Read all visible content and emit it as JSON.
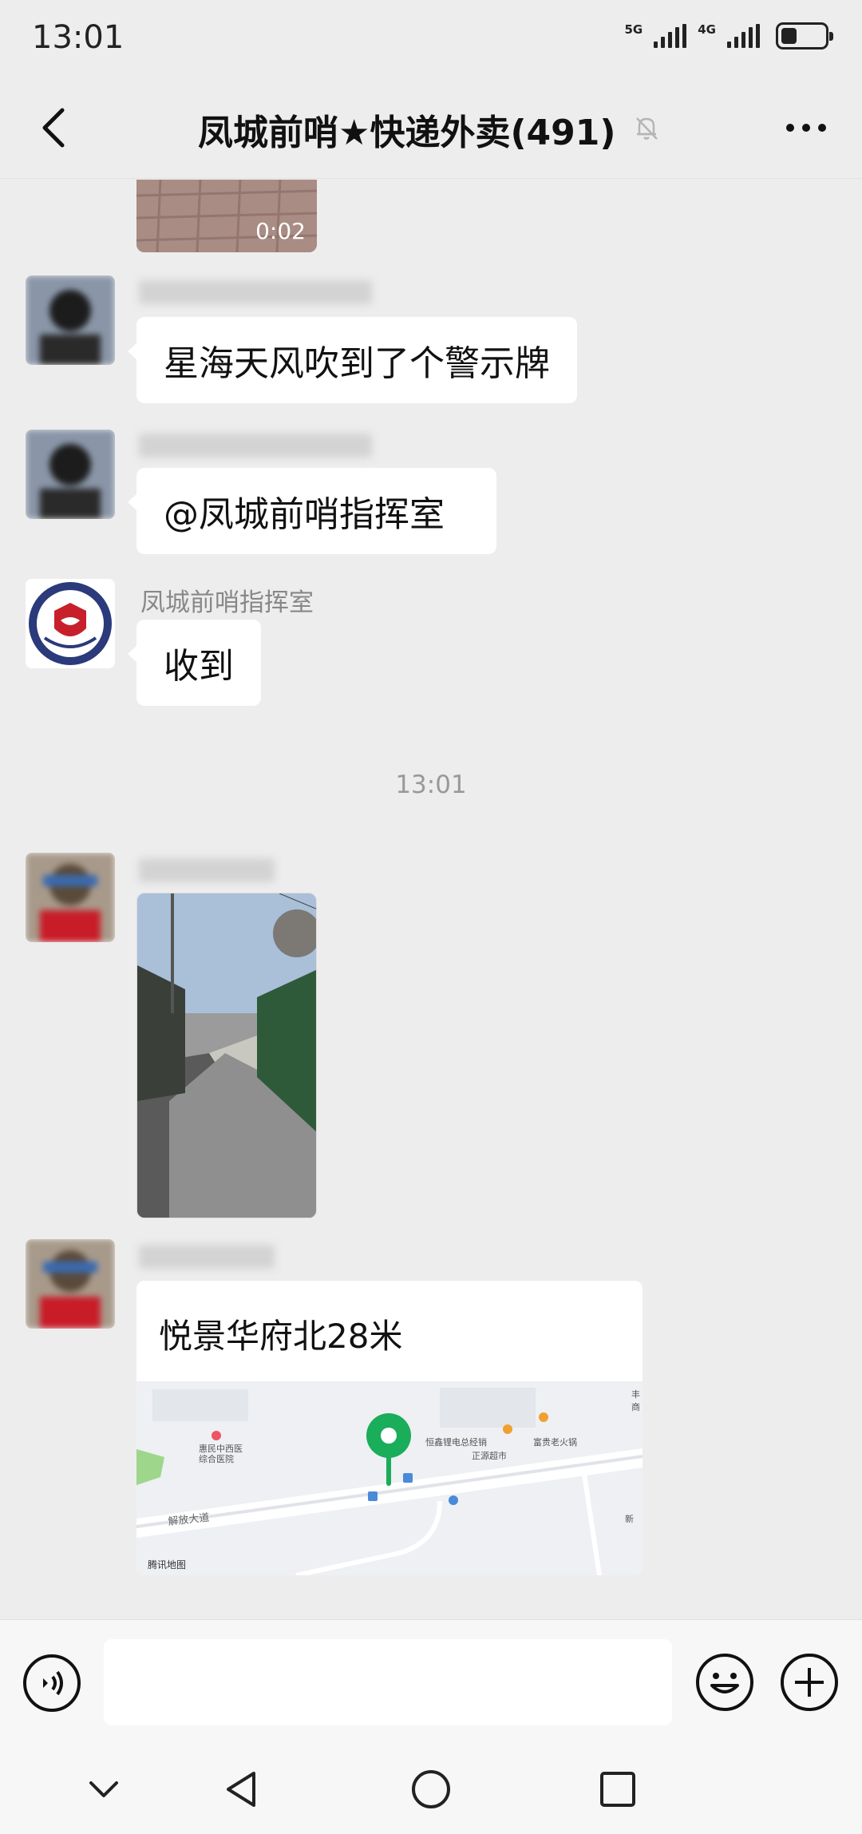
{
  "status_bar": {
    "time": "13:01",
    "network_1": "5G",
    "network_2": "4G",
    "battery_level": 0.35
  },
  "header": {
    "title": "凤城前哨★快递外卖(491)",
    "back_icon": "chevron-left-icon",
    "mute_icon": "bell-off-icon",
    "more_icon": "more-dots-icon"
  },
  "messages": [
    {
      "type": "video",
      "duration": "0:02"
    },
    {
      "type": "text",
      "sender": "",
      "text": "星海天风吹到了个警示牌"
    },
    {
      "type": "text",
      "sender": "",
      "text": "@凤城前哨指挥室"
    },
    {
      "type": "text",
      "sender": "凤城前哨指挥室",
      "text": "收到"
    },
    {
      "type": "timestamp",
      "text": "13:01"
    },
    {
      "type": "image",
      "sender": ""
    },
    {
      "type": "location",
      "sender": "",
      "title": "悦景华府北28米",
      "map_labels": {
        "hospital": "惠民中西医\n综合医院",
        "shop1": "恒鑫锂电总经销",
        "shop2": "富贵老火锅",
        "market": "正源超市",
        "road": "解放大道",
        "right1": "丰",
        "right2": "商",
        "right3": "新",
        "brand": "腾讯地图"
      }
    }
  ],
  "input": {
    "placeholder": "",
    "voice_icon": "voice-icon",
    "emoji_icon": "emoji-icon",
    "plus_icon": "plus-icon"
  },
  "nav": {
    "icons": [
      "chevron-down-icon",
      "back-triangle-icon",
      "home-circle-icon",
      "recents-square-icon"
    ]
  },
  "colors": {
    "background": "#ededed",
    "bubble": "#ffffff",
    "map_pin": "#1aad5a",
    "avatar_blue": "#2a3a7a",
    "avatar_red": "#c8202a"
  }
}
